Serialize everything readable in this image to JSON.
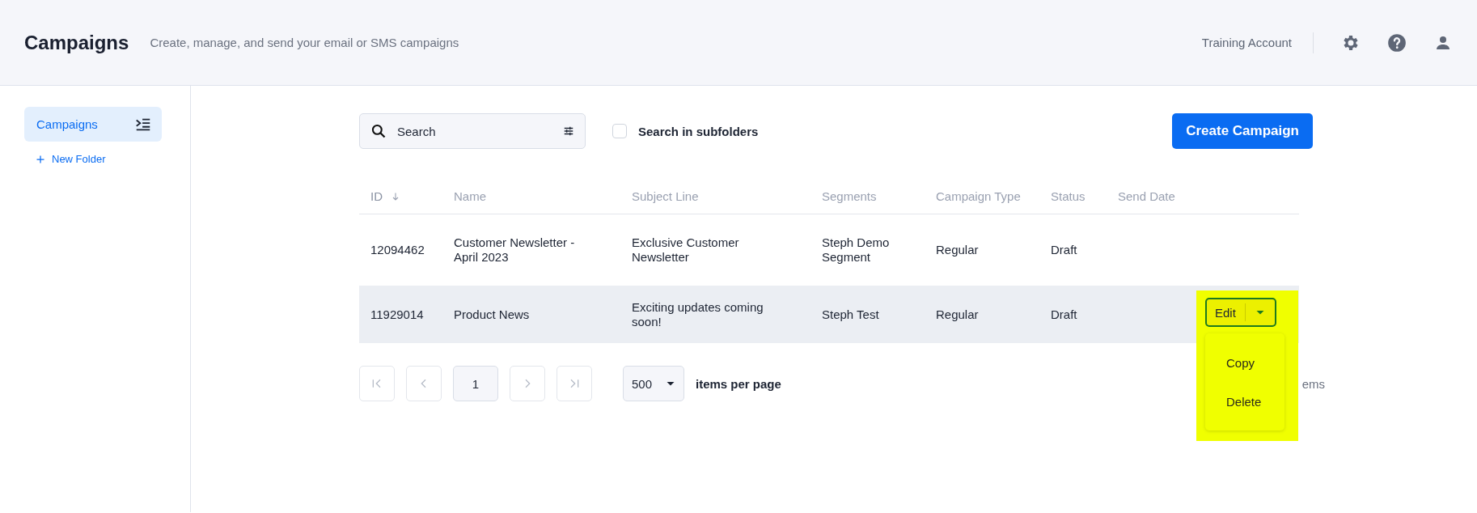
{
  "header": {
    "title": "Campaigns",
    "subtitle": "Create, manage, and send your email or SMS campaigns",
    "account": "Training Account"
  },
  "sidebar": {
    "items": [
      {
        "label": "Campaigns",
        "selected": true
      }
    ],
    "new_folder": "New Folder"
  },
  "toolbar": {
    "search": {
      "placeholder": "Search"
    },
    "subfolders": {
      "label": "Search in subfolders",
      "checked": false
    },
    "create_button": "Create Campaign"
  },
  "table": {
    "columns": [
      {
        "label": "ID",
        "sorted": true
      },
      {
        "label": "Name",
        "sorted": false
      },
      {
        "label": "Subject Line",
        "sorted": false
      },
      {
        "label": "Segments",
        "sorted": false
      },
      {
        "label": "Campaign Type",
        "sorted": false
      },
      {
        "label": "Status",
        "sorted": false
      },
      {
        "label": "Send Date",
        "sorted": false
      }
    ],
    "rows": [
      {
        "cells": [
          "12094462",
          "Customer Newsletter - April 2023",
          "Exclusive Customer Newsletter",
          "Steph Demo Segment",
          "Regular",
          "Draft",
          ""
        ],
        "highlighted": false
      },
      {
        "cells": [
          "11929014",
          "Product News",
          "Exciting updates coming soon!",
          "Steph Test",
          "Regular",
          "Draft",
          ""
        ],
        "highlighted": true,
        "actions": {
          "button": "Edit",
          "expanded": true,
          "spotlight": true,
          "menu": [
            "Copy",
            "Delete"
          ]
        }
      }
    ]
  },
  "pagination": {
    "pages": [
      {
        "label": "1",
        "selected": true
      }
    ],
    "page_size": "500",
    "page_size_label": "items per page",
    "summary": "ems"
  }
}
